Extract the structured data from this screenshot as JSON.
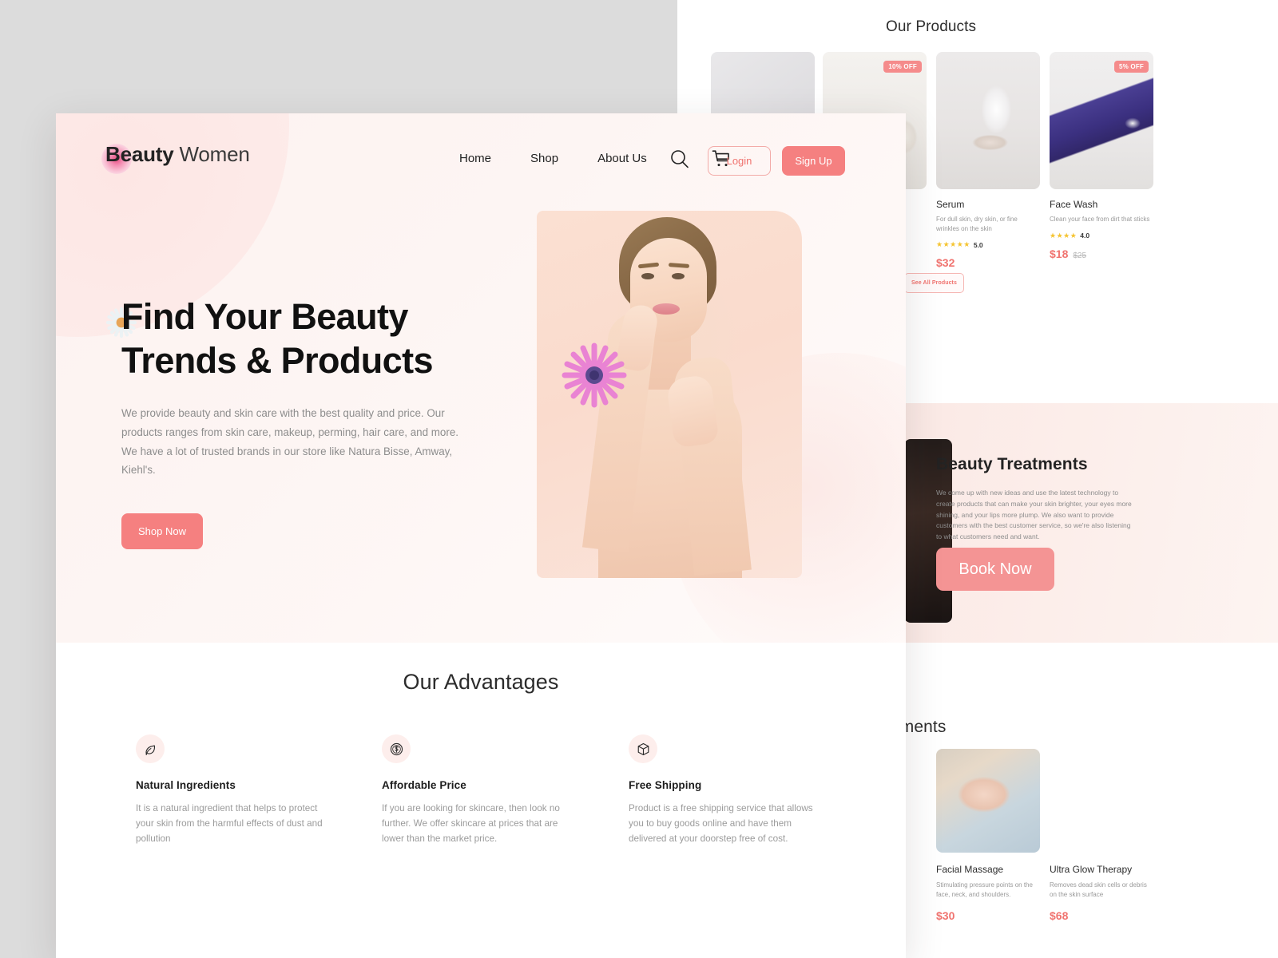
{
  "brand": {
    "name_bold": "Beauty",
    "name_light": " Women"
  },
  "nav": {
    "items": [
      {
        "label": "Home"
      },
      {
        "label": "Shop"
      },
      {
        "label": "About Us"
      }
    ],
    "search_icon": "search-icon",
    "cart_icon": "cart-icon",
    "login_label": "Login",
    "signup_label": "Sign Up"
  },
  "hero": {
    "title_line1": "Find Your Beauty",
    "title_line2": "Trends & Products",
    "description": "We provide beauty and skin care with the best quality and price. Our products ranges from skin care, makeup, perming, hair care, and more. We have a lot of trusted brands in our store like Natura Bisse, Amway, Kiehl's.",
    "cta_label": "Shop Now"
  },
  "advantages": {
    "title": "Our Advantages",
    "items": [
      {
        "icon": "leaf-icon",
        "title": "Natural Ingredients",
        "text": "It is a natural ingredient that helps to protect your skin from the harmful effects of dust and pollution"
      },
      {
        "icon": "coin-dollar-icon",
        "title": "Affordable Price",
        "text": "If you are looking for skincare, then look no further. We offer skincare at prices that are lower than the market price."
      },
      {
        "icon": "box-icon",
        "title": "Free Shipping",
        "text": "Product is a free shipping service that allows you to buy goods online and have them delivered at your doorstep free of cost."
      }
    ]
  },
  "back_page": {
    "products_title": "Our Products",
    "see_all_label": "See All Products",
    "cut_off_text": "!",
    "products": [
      {
        "name": "",
        "desc": "",
        "badge": "",
        "rating": "",
        "stars": "",
        "price": "",
        "old_price": ""
      },
      {
        "name": "",
        "desc": "",
        "badge": "10% OFF",
        "rating": "",
        "stars": "",
        "price": "",
        "old_price": ""
      },
      {
        "name": "Serum",
        "desc": "For dull skin, dry skin, or fine wrinkles on the skin",
        "badge": "",
        "rating": "5.0",
        "stars": "★★★★★",
        "price": "$32",
        "old_price": ""
      },
      {
        "name": "Face Wash",
        "desc": "Clean your face from dirt that sticks",
        "badge": "5% OFF",
        "rating": "4.0",
        "stars": "★★★★",
        "price": "$18",
        "old_price": "$25"
      }
    ],
    "treatments_section": {
      "title": "Beauty Treatments",
      "description": "We come up with new ideas and use the latest technology to create products that can make your skin brighter, your eyes more shining, and your lips more plump. We also want to provide customers with the best customer service, so we're also listening to what customers need and want.",
      "cta_label": "Book Now"
    },
    "treatments_heading": "Treatments",
    "treatments": [
      {
        "name": "",
        "desc": "",
        "price": ""
      },
      {
        "name": "Facial Massage",
        "desc": "Stimulating pressure points on the face, neck, and shoulders.",
        "price": "$30"
      },
      {
        "name": "Ultra Glow Therapy",
        "desc": "Removes dead skin cells or debris on the skin surface",
        "price": "$68"
      }
    ]
  },
  "colors": {
    "accent": "#f58080",
    "accent_text": "#f0736f",
    "badge": "#f58b8b",
    "star": "#f5c431",
    "hero_bg": "#fdf2f1",
    "photo_bg": "#fbe0d2"
  }
}
